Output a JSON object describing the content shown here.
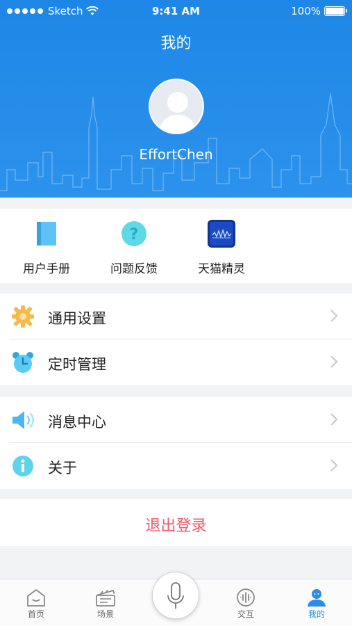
{
  "status_bar": {
    "carrier": "Sketch",
    "time": "9:41 AM",
    "battery": "100%"
  },
  "header": {
    "title": "我的",
    "username": "EffortChen"
  },
  "quick_actions": [
    {
      "label": "用户手册",
      "icon": "manual-book-icon"
    },
    {
      "label": "问题反馈",
      "icon": "question-icon"
    },
    {
      "label": "天猫精灵",
      "icon": "tmall-genie-icon"
    }
  ],
  "menu": {
    "general_settings": "通用设置",
    "timer_management": "定时管理",
    "message_center": "消息中心",
    "about": "关于"
  },
  "logout": "退出登录",
  "tabbar": {
    "home": "首页",
    "scene": "场景",
    "interact": "交互",
    "mine": "我的"
  },
  "colors": {
    "header_blue": "#1e86e6",
    "logout_red": "#f0566b",
    "active_tab": "#2b8be6"
  }
}
